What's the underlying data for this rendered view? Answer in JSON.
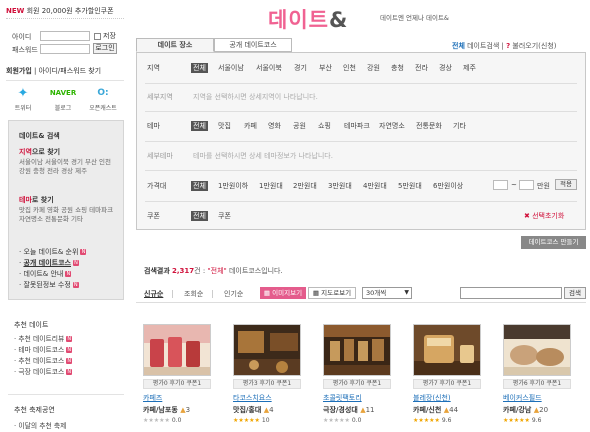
{
  "promo": {
    "new": "NEW",
    "text": "회원 20,000원 추가할인쿠폰"
  },
  "login": {
    "id_label": "아이디",
    "pw_label": "패스워드",
    "save_label": "저장",
    "login_button": "로그인"
  },
  "member": {
    "join": "회원가입",
    "find": " | 아이디/패스워드 찾기"
  },
  "social": [
    {
      "label": "트위터",
      "icon": "twitter-icon",
      "glyph": "t",
      "color": "#29a9e1"
    },
    {
      "label": "블로그",
      "icon": "naver-blog-icon",
      "glyph": "NAVER",
      "color": "#2db400"
    },
    {
      "label": "오픈캐스트",
      "icon": "opencast-icon",
      "glyph": "O:",
      "color": "#3aa7d8"
    }
  ],
  "sidebar_box": {
    "title": "데이트& 검색",
    "region_title_hl": "지역",
    "region_title_rest": "으로 찾기",
    "region_lines": "서울이남  서울이북  경기  부산  인천  강원  충청  전라  경상  제주",
    "theme_title_hl": "테마",
    "theme_title_rest": "로 찾기",
    "theme_lines": "맛집  카페  영화  공원  쇼핑  테마파크  자연명소  전통문화  기타",
    "menu": [
      {
        "label": "오늘 데이트& 순위",
        "badge": "N",
        "style": "normal"
      },
      {
        "label": "공개 데이트코스",
        "badge": "N",
        "style": "strong"
      },
      {
        "label": "데이트& 안내",
        "badge": "N",
        "style": "normal"
      },
      {
        "label": "잘못된정보 수정",
        "badge": "N",
        "style": "normal"
      }
    ]
  },
  "recommended": {
    "title": "추천 데이트",
    "items": [
      "추천 데이트리뷰",
      "테마 데이트코스",
      "추천 데이트코스",
      "극장 데이트코스"
    ]
  },
  "festival": {
    "title": "추천 축제공연",
    "first": "이달의 추천 축제"
  },
  "header": {
    "logo": "데이트",
    "logo_amp": "&",
    "tagline": "데이트엔 언제나 데이트&"
  },
  "tabs": [
    {
      "label": "데이트 장소",
      "active": true
    },
    {
      "label": "공개 데이트코스",
      "active": false
    }
  ],
  "tab_right": {
    "all": "전체",
    "text": " 데이트검색 | ",
    "icon": "?",
    "link": "불러오기(신청)"
  },
  "filters": {
    "region": {
      "label": "지역",
      "options": [
        "전체",
        "서울이남",
        "서울이북",
        "경기",
        "부산",
        "인천",
        "강원",
        "충청",
        "전라",
        "경상",
        "제주"
      ]
    },
    "sub_region": {
      "label": "세부지역",
      "hint": "지역을 선택하시면 상세지역이 나타납니다."
    },
    "theme": {
      "label": "테마",
      "options": [
        "전체",
        "맛집",
        "카페",
        "영화",
        "공원",
        "쇼핑",
        "테마파크",
        "자연명소",
        "전통문화",
        "기타"
      ]
    },
    "sub_theme": {
      "label": "세부테마",
      "hint": "테마를 선택하시면 상세 테마정보가 나타납니다."
    },
    "price": {
      "label": "가격대",
      "options": [
        "전체",
        "1만원이하",
        "1만원대",
        "2만원대",
        "3만원대",
        "4만원대",
        "5만원대",
        "6만원이상"
      ],
      "tilde": "~",
      "unit": "만원",
      "apply": "적용"
    },
    "coupon": {
      "label": "쿠폰",
      "options": [
        "전체",
        "쿠폰"
      ],
      "reset": "선택초기화"
    }
  },
  "make_course_button": "데이트코스 만들기",
  "results": {
    "label": "검색결과",
    "count": "2,317",
    "unit": "건 : ",
    "query": "\"전체\"",
    "suffix": " 데이트코스입니다."
  },
  "sort": {
    "options": [
      {
        "label": "신규순",
        "on": true
      },
      {
        "label": "조회순",
        "on": false
      },
      {
        "label": "인기순",
        "on": false
      }
    ],
    "view_image": "이미지보기",
    "view_map": "지도로보기",
    "per_page": "30개씩",
    "search_button": "검색"
  },
  "cards": [
    {
      "counts": "평가0 후기0 쿠폰1",
      "name": "카페즈",
      "meta": "카페/남포동",
      "likes": "3",
      "score": "0.0",
      "colors": [
        "#b83a3a",
        "#e8b7b0",
        "#f2e4d4"
      ]
    },
    {
      "counts": "평가3 후기0 쿠폰1",
      "name": "타코스치요스",
      "meta": "맛집/홍대",
      "likes": "4",
      "score": "10",
      "colors": [
        "#5a3b22",
        "#a8753a",
        "#3d2a1a"
      ]
    },
    {
      "counts": "평가0 후기0 쿠폰1",
      "name": "초콜릿팩토리",
      "meta": "극장/경성대",
      "likes": "11",
      "score": "0.0",
      "colors": [
        "#3a2616",
        "#8c5a2e",
        "#c69a5c"
      ]
    },
    {
      "counts": "평가7 후기0 쿠폰1",
      "name": "블레장(신천)",
      "meta": "카페/신천",
      "likes": "44",
      "score": "9.6",
      "colors": [
        "#6e4a2a",
        "#d6a662",
        "#f0d8a8"
      ]
    },
    {
      "counts": "평가6 후기0 쿠폰1",
      "name": "베이커스필드",
      "meta": "카페/강남",
      "likes": "20",
      "score": "9.6",
      "colors": [
        "#4a3a2e",
        "#c9a27a",
        "#efe3cf"
      ]
    }
  ]
}
